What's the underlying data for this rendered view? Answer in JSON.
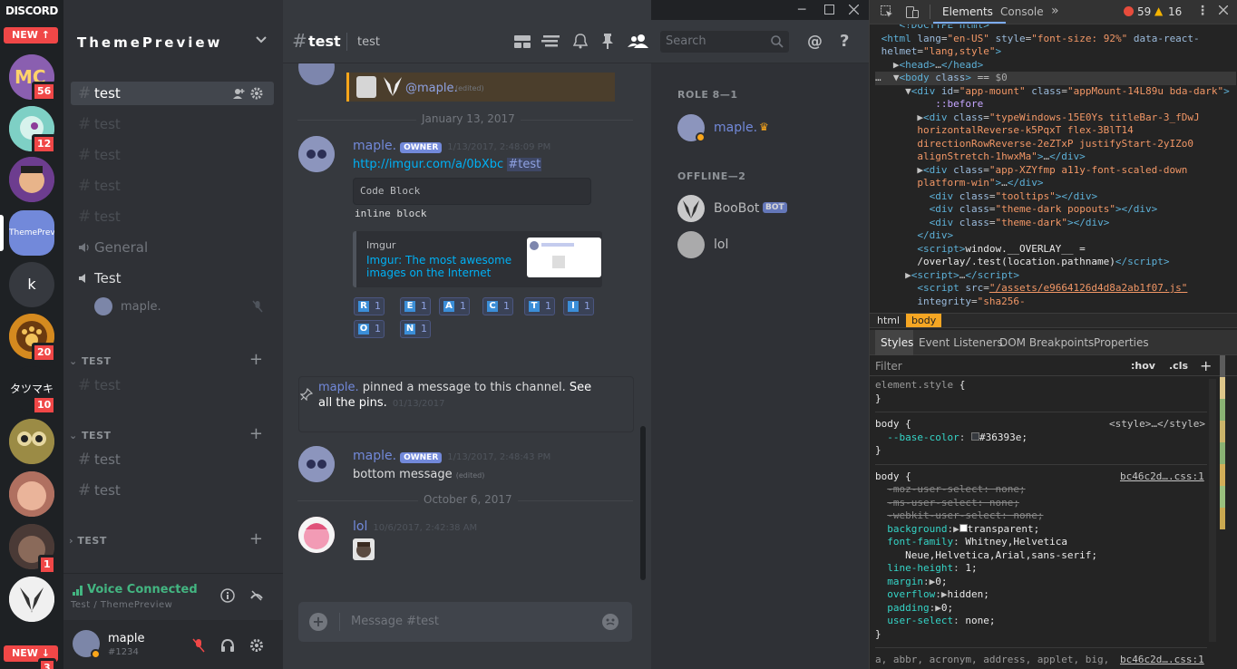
{
  "guilds": {
    "brand": "DISCORD",
    "new_top": "NEW ↑",
    "new_bottom": "NEW ↓",
    "badge_1": "56",
    "badge_2": "12",
    "active_label": "ThemePrevi",
    "k_label": "k",
    "badge_5": "20",
    "kanji_label": "タツマキ",
    "badge_6": "10",
    "badge_9": "1",
    "badge_11": "3"
  },
  "sidebar": {
    "guild_name": "ThemePreview",
    "channels": [
      {
        "name": "test",
        "selected": true
      },
      {
        "name": "test"
      },
      {
        "name": "test"
      },
      {
        "name": "test"
      },
      {
        "name": "test"
      }
    ],
    "voice_general": "General",
    "voice_test": "Test",
    "voice_user": "maple.",
    "categories": [
      "TEST",
      "TEST",
      "TEST"
    ],
    "cat1_channel": "test",
    "cat2_channels": [
      "test",
      "test"
    ],
    "voice_status": "Voice Connected",
    "voice_location": "Test / ThemePreview",
    "username": "maple",
    "discriminator": "#1234"
  },
  "chat": {
    "channel_hash": "#",
    "channel_name": "test",
    "topic": "test",
    "search_placeholder": "Search",
    "top_mention": "@maple.",
    "top_edited": "(edited)",
    "date_1": "January 13, 2017",
    "msg1": {
      "author": "maple.",
      "badge": "OWNER",
      "time": "1/13/2017, 2:48:09 PM",
      "link": "http://imgur.com/a/0bXbc",
      "channel_mention": "#test",
      "code_block": "Code Block",
      "inline_block": "inline block",
      "embed_provider": "Imgur",
      "embed_title": "Imgur: The most awesome images on the Internet"
    },
    "reactions": [
      {
        "letter": "R",
        "count": "1"
      },
      {
        "letter": "E",
        "count": "1"
      },
      {
        "letter": "A",
        "count": "1"
      },
      {
        "letter": "C",
        "count": "1"
      },
      {
        "letter": "T",
        "count": "1"
      },
      {
        "letter": "I",
        "count": "1"
      },
      {
        "letter": "O",
        "count": "1"
      },
      {
        "letter": "N",
        "count": "1"
      }
    ],
    "pin": {
      "author": "maple.",
      "text": " pinned a message to this channel. ",
      "see_all": "See all the pins.",
      "time": "01/13/2017"
    },
    "msg2": {
      "author": "maple.",
      "badge": "OWNER",
      "time": "1/13/2017, 2:48:43 PM",
      "text": "bottom message",
      "edited": "(edited)"
    },
    "date_2": "October 6, 2017",
    "msg3": {
      "author": "lol",
      "time": "10/6/2017, 2:42:38 AM"
    },
    "input_placeholder": "Message #test"
  },
  "members": {
    "role_header": "ROLE 8—1",
    "role_member": "maple.",
    "offline_header": "OFFLINE—2",
    "offline_1": "BooBot",
    "bot_tag": "BOT",
    "offline_2": "lol"
  },
  "devtools": {
    "tab_elements": "Elements",
    "tab_console": "Console",
    "tab_more": "»",
    "errors": "59",
    "warnings": "16",
    "crumb_html": "html",
    "crumb_body": "body",
    "sub_styles": "Styles",
    "sub_listeners": "Event Listeners",
    "sub_dom": "DOM Breakpoints",
    "sub_props": "Properties",
    "filter": "Filter",
    "hov": ":hov",
    "cls": ".cls",
    "plus": "+",
    "style_src_1": "<style>…</style>",
    "css_link_1": "bc46c2d….css:1",
    "css_link_2": "bc46c2d….css:1",
    "color_accent": "#f5a623"
  }
}
